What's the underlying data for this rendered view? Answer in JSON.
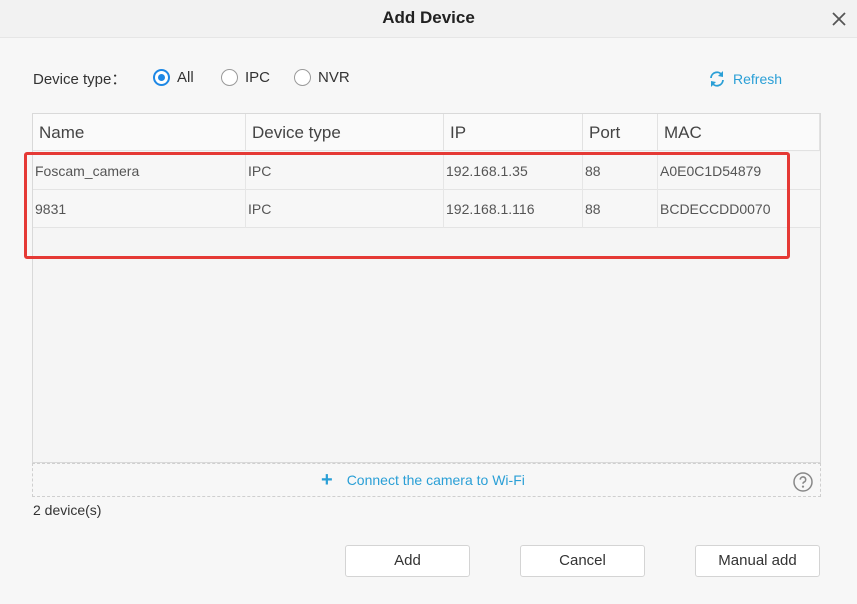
{
  "window": {
    "title": "Add Device",
    "close_icon": "close-icon"
  },
  "filter": {
    "label": "Device type：",
    "options": [
      {
        "label": "All",
        "checked": true
      },
      {
        "label": "IPC",
        "checked": false
      },
      {
        "label": "NVR",
        "checked": false
      }
    ],
    "refresh_label": "Refresh",
    "refresh_icon": "refresh-icon"
  },
  "table": {
    "columns": [
      "Name",
      "Device type",
      "IP",
      "Port",
      "MAC"
    ],
    "rows": [
      [
        "Foscam_camera",
        "IPC",
        "192.168.1.35",
        "88",
        "A0E0C1D54879"
      ],
      [
        "9831",
        "IPC",
        "192.168.1.116",
        "88",
        "BCDECCDD0070"
      ]
    ]
  },
  "wifi": {
    "label": "Connect the camera to Wi-Fi",
    "plus_icon": "plus-icon",
    "help_icon": "help-icon"
  },
  "status": {
    "count_text": "2  device(s)"
  },
  "buttons": {
    "add": "Add",
    "cancel": "Cancel",
    "manual_add": "Manual add"
  },
  "colors": {
    "accent": "#2a9fd6",
    "radio": "#1e88e5",
    "highlight": "#e53935"
  }
}
